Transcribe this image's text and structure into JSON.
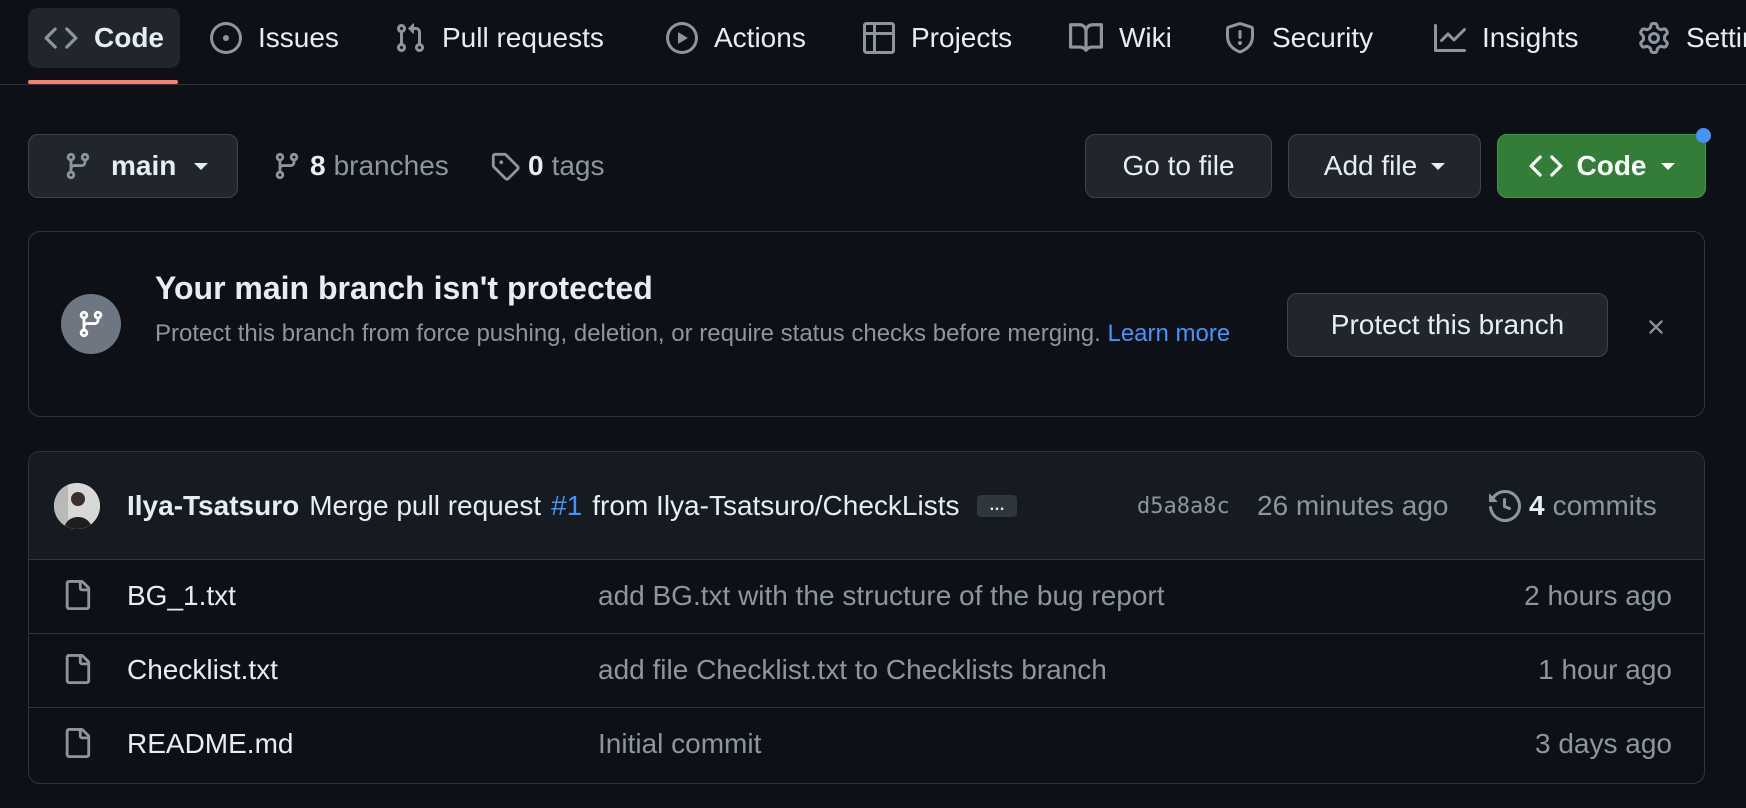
{
  "nav": {
    "tabs": [
      {
        "label": "Code",
        "icon": "code-icon",
        "active": true
      },
      {
        "label": "Issues",
        "icon": "issue-opened-icon"
      },
      {
        "label": "Pull requests",
        "icon": "git-pull-request-icon"
      },
      {
        "label": "Actions",
        "icon": "play-icon"
      },
      {
        "label": "Projects",
        "icon": "table-icon"
      },
      {
        "label": "Wiki",
        "icon": "book-icon"
      },
      {
        "label": "Security",
        "icon": "shield-icon"
      },
      {
        "label": "Insights",
        "icon": "graph-icon"
      },
      {
        "label": "Settings",
        "icon": "gear-icon"
      }
    ],
    "accent_color": "#f78166"
  },
  "toolbar": {
    "branch_label": "main",
    "branches_count": "8",
    "branches_label": "branches",
    "tags_count": "0",
    "tags_label": "tags",
    "go_to_file": "Go to file",
    "add_file": "Add file",
    "code_button": "Code",
    "code_button_color": "#347d39",
    "notification_dot_color": "#4493f8"
  },
  "banner": {
    "title": "Your main branch isn't protected",
    "text": "Protect this branch from force pushing, deletion, or require status checks before merging.",
    "link_text": "Learn more",
    "button": "Protect this branch"
  },
  "commit": {
    "author": "Ilya-Tsatsuro",
    "message_prefix": "Merge pull request",
    "pr_ref": "#1",
    "message_suffix": "from Ilya-Tsatsuro/CheckLists",
    "ellipsis": "…",
    "sha": "d5a8a8c",
    "time": "26 minutes ago",
    "commits_count": "4",
    "commits_label": "commits"
  },
  "files": [
    {
      "name": "BG_1.txt",
      "message": "add BG.txt with the structure of the bug report",
      "time": "2 hours ago"
    },
    {
      "name": "Checklist.txt",
      "message": "add file Checklist.txt to Checklists branch",
      "time": "1 hour ago"
    },
    {
      "name": "README.md",
      "message": "Initial commit",
      "time": "3 days ago"
    }
  ]
}
